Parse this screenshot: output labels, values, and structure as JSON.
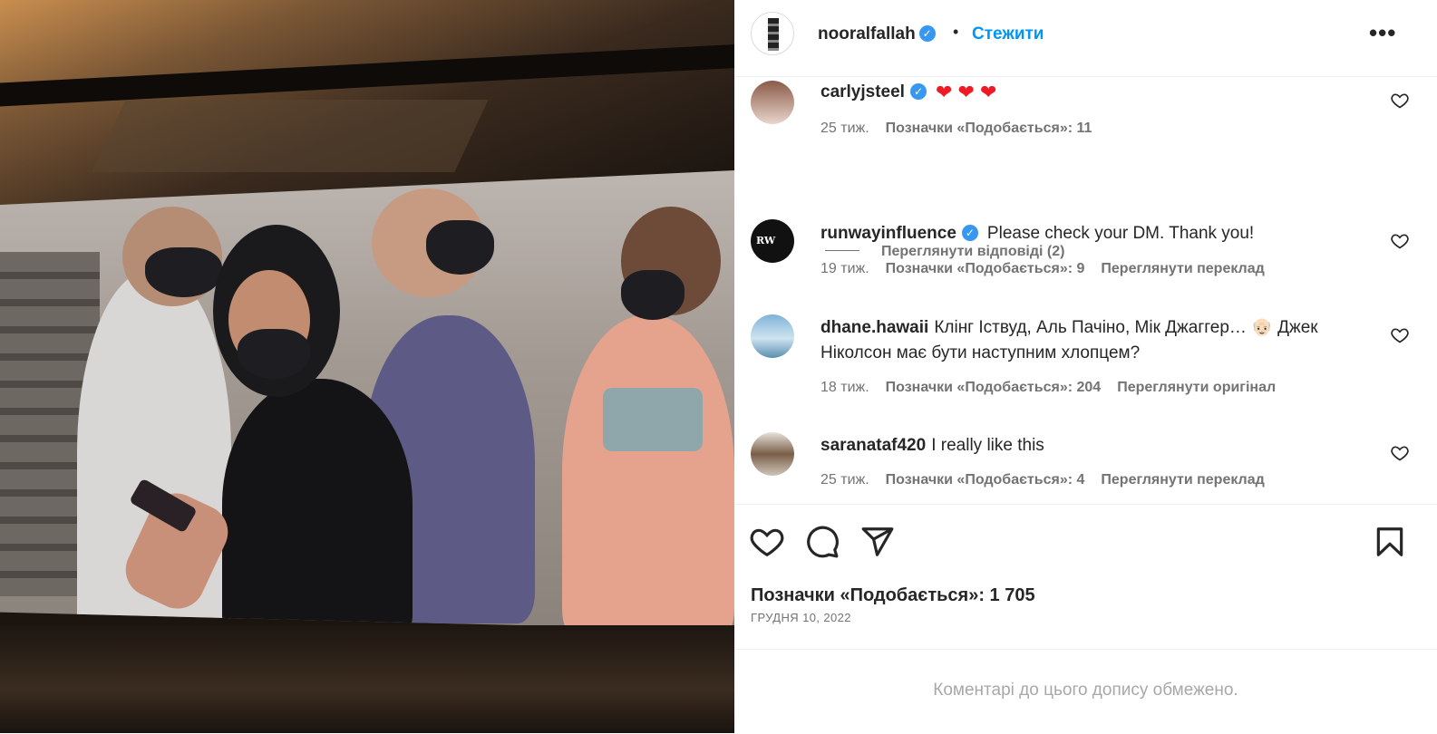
{
  "post": {
    "author": "nooralfallah",
    "follow_label": "Стежити",
    "more_label": "•••"
  },
  "comments": [
    {
      "username": "carlyjsteel",
      "text": "❤ ❤ ❤",
      "time": "25 тиж.",
      "likes": "Позначки «Подобається»: 11",
      "view_replies": "Переглянути відповіді (2)"
    },
    {
      "username": "runwayinfluence",
      "text": "Please check your DM. Thank you!",
      "time": "19 тиж.",
      "likes": "Позначки «Подобається»: 9",
      "extra": "Переглянути переклад"
    },
    {
      "username": "dhane.hawaii",
      "text": "Клінг Іствуд, Аль Пачіно, Мік Джаггер… 👴🏻 Джек Ніколсон має бути наступним хлопцем?",
      "time": "18 тиж.",
      "likes": "Позначки «Подобається»: 204",
      "extra": "Переглянути оригінал"
    },
    {
      "username": "saranataf420",
      "text": "I really like this",
      "time": "25 тиж.",
      "likes": "Позначки «Подобається»: 4",
      "extra": "Переглянути переклад"
    }
  ],
  "actions": {
    "likes_total": "Позначки «Подобається»: 1 705",
    "date": "ГРУДНЯ 10, 2022"
  },
  "footer": {
    "comments_limited": "Коментарі до цього допису обмежено."
  },
  "icons": {
    "verified": "verified-badge-icon",
    "like": "heart-icon",
    "comment": "comment-bubble-icon",
    "share": "paper-plane-icon",
    "save": "bookmark-icon",
    "more": "more-dots-icon"
  },
  "colors": {
    "link_blue": "#0095f6",
    "verified_blue": "#3897f0",
    "muted": "#737373"
  }
}
